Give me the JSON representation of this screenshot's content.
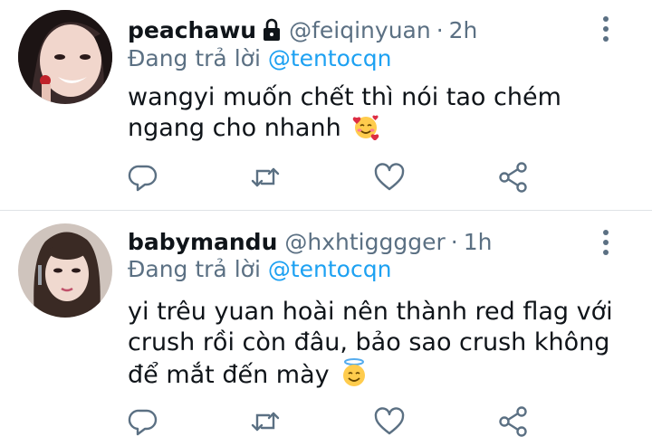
{
  "tweets": [
    {
      "display_name": "peachawu",
      "handle": "@feiqinyuan",
      "separator": "·",
      "time": "2h",
      "reply_prefix": "Đang trả lời",
      "reply_to": "@tentocqn",
      "text": "wangyi muốn chết thì nói tao chém ngang cho nhanh",
      "emoji": "smiling-face-with-hearts",
      "locked": true
    },
    {
      "display_name": "babymandu",
      "handle": "@hxhtigggger",
      "separator": "·",
      "time": "1h",
      "reply_prefix": "Đang trả lời",
      "reply_to": "@tentocqn",
      "text": "yi trêu yuan hoài nên thành red flag với crush rồi còn đâu, bảo sao crush không để mắt đến mày",
      "emoji": "smiling-face-with-halo",
      "locked": false
    }
  ],
  "colors": {
    "text": "#0f1419",
    "secondary": "#5b7083",
    "mention": "#1da1f2",
    "icon": "#5b7083",
    "divider": "#dfe3e6"
  }
}
